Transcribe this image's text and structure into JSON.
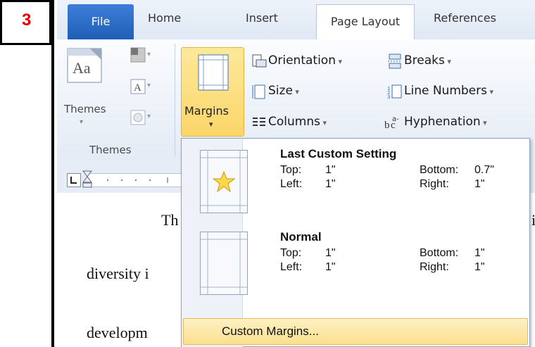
{
  "step_badge": "3",
  "tabs": {
    "file": "File",
    "home": "Home",
    "insert": "Insert",
    "page_layout": "Page Layout",
    "references": "References"
  },
  "ribbon": {
    "themes_button": "Themes",
    "themes_group": "Themes",
    "margins": "Margins",
    "orientation": "Orientation",
    "size": "Size",
    "columns": "Columns",
    "breaks": "Breaks",
    "line_numbers": "Line Numbers",
    "hyphenation": "Hyphenation"
  },
  "document": {
    "line1": "Th",
    "line2": "diversity i",
    "line3": "developm",
    "right_edge": "i"
  },
  "margins_menu": {
    "items": [
      {
        "title": "Last Custom Setting",
        "top_label": "Top:",
        "top_value": "1\"",
        "bottom_label": "Bottom:",
        "bottom_value": "0.7\"",
        "left_label": "Left:",
        "left_value": "1\"",
        "right_label": "Right:",
        "right_value": "1\""
      },
      {
        "title": "Normal",
        "top_label": "Top:",
        "top_value": "1\"",
        "bottom_label": "Bottom:",
        "bottom_value": "1\"",
        "left_label": "Left:",
        "left_value": "1\"",
        "right_label": "Right:",
        "right_value": "1\""
      }
    ],
    "custom_margins": "Custom Margins..."
  },
  "colors": {
    "badge_text": "#e00000",
    "file_tab": "#2b6cc4",
    "highlight": "#fbd66a"
  }
}
